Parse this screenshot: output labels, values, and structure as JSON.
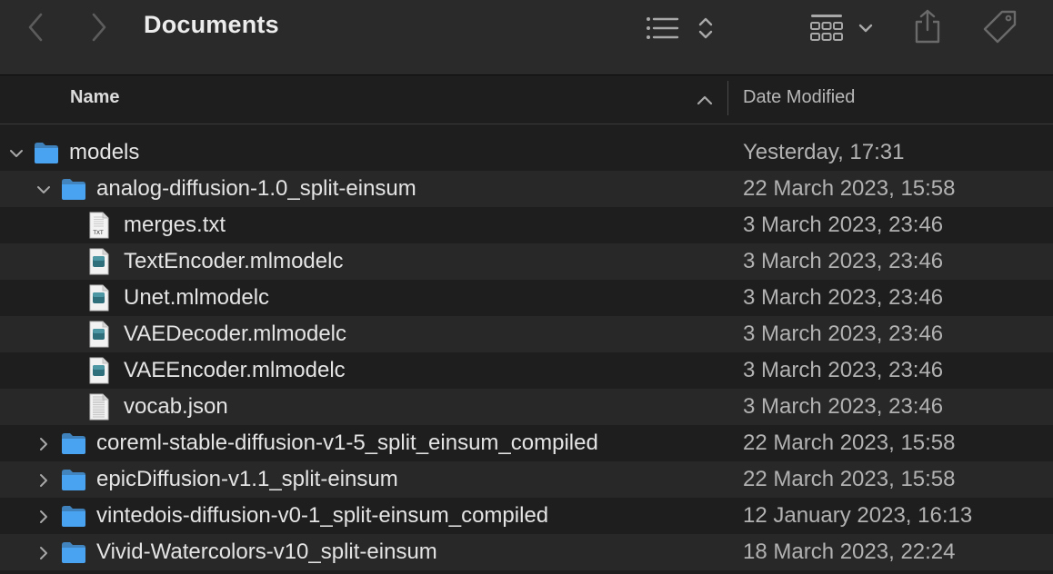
{
  "window": {
    "title": "Documents",
    "toolbar": {
      "back_icon": "chevron-left-icon",
      "forward_icon": "chevron-right-icon",
      "list_view_icon": "list-icon",
      "sort_icon": "up-down-chevron-icon",
      "grid_view_icon": "grid-icon",
      "grid_dropdown_icon": "chevron-down-icon",
      "share_icon": "share-icon",
      "tag_icon": "tag-icon"
    }
  },
  "columns": {
    "name": "Name",
    "date_modified": "Date Modified",
    "sort_direction_icon": "chevron-up-icon"
  },
  "colors": {
    "folder": "#4aa3f0",
    "background": "#1e1e1e",
    "alt_row": "#282828",
    "toolbar": "#2a2a2a"
  },
  "rows": [
    {
      "name": "models",
      "date": "Yesterday, 17:31",
      "kind": "folder",
      "level": 0,
      "expanded": true
    },
    {
      "name": "analog-diffusion-1.0_split-einsum",
      "date": "22 March 2023, 15:58",
      "kind": "folder",
      "level": 1,
      "expanded": true
    },
    {
      "name": "merges.txt",
      "date": "3 March 2023, 23:46",
      "kind": "txt",
      "level": 2
    },
    {
      "name": "TextEncoder.mlmodelc",
      "date": "3 March 2023, 23:46",
      "kind": "mlmodel",
      "level": 2
    },
    {
      "name": "Unet.mlmodelc",
      "date": "3 March 2023, 23:46",
      "kind": "mlmodel",
      "level": 2
    },
    {
      "name": "VAEDecoder.mlmodelc",
      "date": "3 March 2023, 23:46",
      "kind": "mlmodel",
      "level": 2
    },
    {
      "name": "VAEEncoder.mlmodelc",
      "date": "3 March 2023, 23:46",
      "kind": "mlmodel",
      "level": 2
    },
    {
      "name": "vocab.json",
      "date": "3 March 2023, 23:46",
      "kind": "json",
      "level": 2
    },
    {
      "name": "coreml-stable-diffusion-v1-5_split_einsum_compiled",
      "date": "22 March 2023, 15:58",
      "kind": "folder",
      "level": 1,
      "expanded": false
    },
    {
      "name": "epicDiffusion-v1.1_split-einsum",
      "date": "22 March 2023, 15:58",
      "kind": "folder",
      "level": 1,
      "expanded": false
    },
    {
      "name": "vintedois-diffusion-v0-1_split-einsum_compiled",
      "date": "12 January 2023, 16:13",
      "kind": "folder",
      "level": 1,
      "expanded": false
    },
    {
      "name": "Vivid-Watercolors-v10_split-einsum",
      "date": "18 March 2023, 22:24",
      "kind": "folder",
      "level": 1,
      "expanded": false
    }
  ],
  "file_badge_txt": "TXT"
}
